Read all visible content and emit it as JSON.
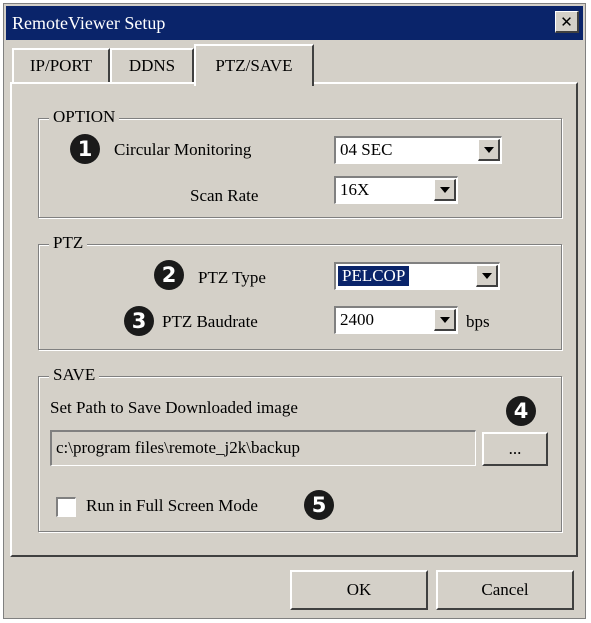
{
  "window": {
    "title": "RemoteViewer Setup"
  },
  "tabs": [
    {
      "label": "IP/PORT"
    },
    {
      "label": "DDNS"
    },
    {
      "label": "PTZ/SAVE",
      "active": true
    }
  ],
  "option_group": {
    "title": "OPTION",
    "marker": "1",
    "circular_monitoring": {
      "label": "Circular Monitoring",
      "value": "04 SEC"
    },
    "scan_rate": {
      "label": "Scan Rate",
      "value": "16X"
    }
  },
  "ptz_group": {
    "title": "PTZ",
    "ptz_type": {
      "marker": "2",
      "label": "PTZ Type",
      "value": "PELCOP"
    },
    "ptz_baudrate": {
      "marker": "3",
      "label": "PTZ Baudrate",
      "value": "2400",
      "unit": "bps"
    }
  },
  "save_group": {
    "title": "SAVE",
    "path_label": "Set Path to Save Downloaded image",
    "path_value": "c:\\program files\\remote_j2k\\backup",
    "browse_marker": "4",
    "browse_label": "...",
    "fullscreen": {
      "label": "Run in Full Screen Mode",
      "checked": false,
      "marker": "5"
    }
  },
  "buttons": {
    "ok": "OK",
    "cancel": "Cancel"
  },
  "colors": {
    "face": "#d4d0c8",
    "titlebar": "#0a246a",
    "selection": "#0a246a"
  }
}
